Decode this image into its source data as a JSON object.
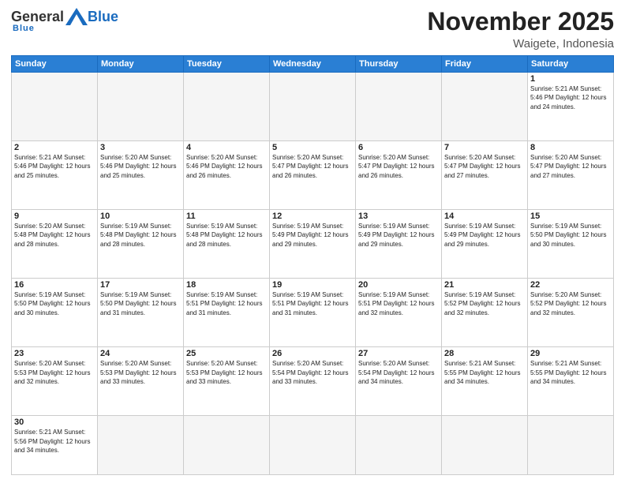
{
  "header": {
    "logo": {
      "general": "General",
      "blue": "Blue",
      "sub": "Blue"
    },
    "title": "November 2025",
    "subtitle": "Waigete, Indonesia"
  },
  "weekdays": [
    "Sunday",
    "Monday",
    "Tuesday",
    "Wednesday",
    "Thursday",
    "Friday",
    "Saturday"
  ],
  "weeks": [
    [
      {
        "day": null,
        "info": ""
      },
      {
        "day": null,
        "info": ""
      },
      {
        "day": null,
        "info": ""
      },
      {
        "day": null,
        "info": ""
      },
      {
        "day": null,
        "info": ""
      },
      {
        "day": null,
        "info": ""
      },
      {
        "day": "1",
        "info": "Sunrise: 5:21 AM\nSunset: 5:46 PM\nDaylight: 12 hours\nand 24 minutes."
      }
    ],
    [
      {
        "day": "2",
        "info": "Sunrise: 5:21 AM\nSunset: 5:46 PM\nDaylight: 12 hours\nand 25 minutes."
      },
      {
        "day": "3",
        "info": "Sunrise: 5:20 AM\nSunset: 5:46 PM\nDaylight: 12 hours\nand 25 minutes."
      },
      {
        "day": "4",
        "info": "Sunrise: 5:20 AM\nSunset: 5:46 PM\nDaylight: 12 hours\nand 26 minutes."
      },
      {
        "day": "5",
        "info": "Sunrise: 5:20 AM\nSunset: 5:47 PM\nDaylight: 12 hours\nand 26 minutes."
      },
      {
        "day": "6",
        "info": "Sunrise: 5:20 AM\nSunset: 5:47 PM\nDaylight: 12 hours\nand 26 minutes."
      },
      {
        "day": "7",
        "info": "Sunrise: 5:20 AM\nSunset: 5:47 PM\nDaylight: 12 hours\nand 27 minutes."
      },
      {
        "day": "8",
        "info": "Sunrise: 5:20 AM\nSunset: 5:47 PM\nDaylight: 12 hours\nand 27 minutes."
      }
    ],
    [
      {
        "day": "9",
        "info": "Sunrise: 5:20 AM\nSunset: 5:48 PM\nDaylight: 12 hours\nand 28 minutes."
      },
      {
        "day": "10",
        "info": "Sunrise: 5:19 AM\nSunset: 5:48 PM\nDaylight: 12 hours\nand 28 minutes."
      },
      {
        "day": "11",
        "info": "Sunrise: 5:19 AM\nSunset: 5:48 PM\nDaylight: 12 hours\nand 28 minutes."
      },
      {
        "day": "12",
        "info": "Sunrise: 5:19 AM\nSunset: 5:49 PM\nDaylight: 12 hours\nand 29 minutes."
      },
      {
        "day": "13",
        "info": "Sunrise: 5:19 AM\nSunset: 5:49 PM\nDaylight: 12 hours\nand 29 minutes."
      },
      {
        "day": "14",
        "info": "Sunrise: 5:19 AM\nSunset: 5:49 PM\nDaylight: 12 hours\nand 29 minutes."
      },
      {
        "day": "15",
        "info": "Sunrise: 5:19 AM\nSunset: 5:50 PM\nDaylight: 12 hours\nand 30 minutes."
      }
    ],
    [
      {
        "day": "16",
        "info": "Sunrise: 5:19 AM\nSunset: 5:50 PM\nDaylight: 12 hours\nand 30 minutes."
      },
      {
        "day": "17",
        "info": "Sunrise: 5:19 AM\nSunset: 5:50 PM\nDaylight: 12 hours\nand 31 minutes."
      },
      {
        "day": "18",
        "info": "Sunrise: 5:19 AM\nSunset: 5:51 PM\nDaylight: 12 hours\nand 31 minutes."
      },
      {
        "day": "19",
        "info": "Sunrise: 5:19 AM\nSunset: 5:51 PM\nDaylight: 12 hours\nand 31 minutes."
      },
      {
        "day": "20",
        "info": "Sunrise: 5:19 AM\nSunset: 5:51 PM\nDaylight: 12 hours\nand 32 minutes."
      },
      {
        "day": "21",
        "info": "Sunrise: 5:19 AM\nSunset: 5:52 PM\nDaylight: 12 hours\nand 32 minutes."
      },
      {
        "day": "22",
        "info": "Sunrise: 5:20 AM\nSunset: 5:52 PM\nDaylight: 12 hours\nand 32 minutes."
      }
    ],
    [
      {
        "day": "23",
        "info": "Sunrise: 5:20 AM\nSunset: 5:53 PM\nDaylight: 12 hours\nand 32 minutes."
      },
      {
        "day": "24",
        "info": "Sunrise: 5:20 AM\nSunset: 5:53 PM\nDaylight: 12 hours\nand 33 minutes."
      },
      {
        "day": "25",
        "info": "Sunrise: 5:20 AM\nSunset: 5:53 PM\nDaylight: 12 hours\nand 33 minutes."
      },
      {
        "day": "26",
        "info": "Sunrise: 5:20 AM\nSunset: 5:54 PM\nDaylight: 12 hours\nand 33 minutes."
      },
      {
        "day": "27",
        "info": "Sunrise: 5:20 AM\nSunset: 5:54 PM\nDaylight: 12 hours\nand 34 minutes."
      },
      {
        "day": "28",
        "info": "Sunrise: 5:21 AM\nSunset: 5:55 PM\nDaylight: 12 hours\nand 34 minutes."
      },
      {
        "day": "29",
        "info": "Sunrise: 5:21 AM\nSunset: 5:55 PM\nDaylight: 12 hours\nand 34 minutes."
      }
    ],
    [
      {
        "day": "30",
        "info": "Sunrise: 5:21 AM\nSunset: 5:56 PM\nDaylight: 12 hours\nand 34 minutes."
      },
      {
        "day": null,
        "info": ""
      },
      {
        "day": null,
        "info": ""
      },
      {
        "day": null,
        "info": ""
      },
      {
        "day": null,
        "info": ""
      },
      {
        "day": null,
        "info": ""
      },
      {
        "day": null,
        "info": ""
      }
    ]
  ]
}
